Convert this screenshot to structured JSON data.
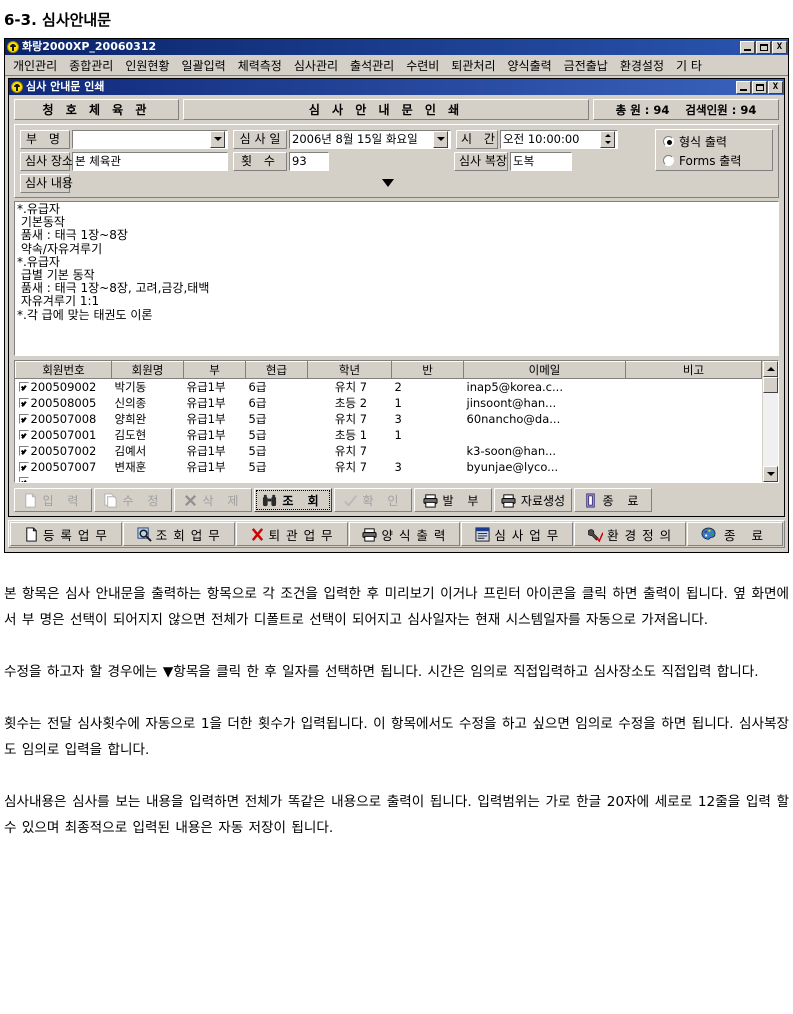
{
  "page": {
    "heading": "6-3. 심사안내문"
  },
  "app_window": {
    "title": "화랑2000XP_20060312",
    "controls": {
      "minimize": "_",
      "maximize": "□",
      "close": "X"
    },
    "menu": [
      "개인관리",
      "종합관리",
      "인원현황",
      "일괄입력",
      "체력측정",
      "심사관리",
      "출석관리",
      "수련비",
      "퇴관처리",
      "양식출력",
      "금전출납",
      "환경설정",
      "기 타"
    ]
  },
  "child_window": {
    "title": "심사 안내문 인쇄",
    "controls": {
      "minimize": "_",
      "maximize": "□",
      "close": "X"
    },
    "header": {
      "gym": "청 호 체 육 관",
      "title": "심 사 안 내 문 인 쇄",
      "total_label": "총 원 : 94",
      "searched_label": "검색인원 : 94"
    },
    "form": {
      "dept_label": "부   명",
      "dept_value": "",
      "exam_date_label": "심 사 일",
      "exam_date_value": "2006년  8월 15일 화요일",
      "time_label": "시   간",
      "time_value": "오전 10:00:00",
      "place_label": "심사 장소",
      "place_value": "본 체육관",
      "count_label": "횟   수",
      "count_value": "93",
      "uniform_label": "심사 복장",
      "uniform_value": "도복",
      "content_label": "심사 내용",
      "print_mode": {
        "option1": "형식 출력",
        "option2": "Forms 출력",
        "selected": "형식 출력"
      }
    },
    "memo": "*.유급자\n 기본동작\n 품새 : 태극 1장~8장\n 약속/자유겨루기\n*.유급자\n 급별 기본 동작\n 품새 : 태극 1장~8장, 고려,금강,태백\n 자유겨루기 1:1\n*.각 급에 맞는 태권도 이론",
    "grid": {
      "columns": [
        "회원번호",
        "회원명",
        "부",
        "현급",
        "학년",
        "반",
        "이메일",
        "비고"
      ],
      "rows": [
        {
          "checked": true,
          "no": "200509002",
          "name": "박기동",
          "dept": "유급1부",
          "grade": "6급",
          "school": "유치 7",
          "class": "2",
          "email": "inap5@korea.c...",
          "note": ""
        },
        {
          "checked": true,
          "no": "200508005",
          "name": "신의종",
          "dept": "유급1부",
          "grade": "6급",
          "school": "초등 2",
          "class": "1",
          "email": "jinsoont@han...",
          "note": ""
        },
        {
          "checked": true,
          "no": "200507008",
          "name": "양희완",
          "dept": "유급1부",
          "grade": "5급",
          "school": "유치 7",
          "class": "3",
          "email": "60nancho@da...",
          "note": ""
        },
        {
          "checked": true,
          "no": "200507001",
          "name": "김도현",
          "dept": "유급1부",
          "grade": "5급",
          "school": "초등 1",
          "class": "1",
          "email": "",
          "note": ""
        },
        {
          "checked": true,
          "no": "200507002",
          "name": "김예서",
          "dept": "유급1부",
          "grade": "5급",
          "school": "유치 7",
          "class": "",
          "email": "k3-soon@han...",
          "note": ""
        },
        {
          "checked": true,
          "no": "200507007",
          "name": "변재훈",
          "dept": "유급1부",
          "grade": "5급",
          "school": "유치 7",
          "class": "3",
          "email": "byunjae@lyco...",
          "note": ""
        }
      ]
    },
    "actions": [
      {
        "name": "input",
        "label": "입    력",
        "icon": "document-icon",
        "state": "disabled"
      },
      {
        "name": "modify",
        "label": "수    정",
        "icon": "copy-icon",
        "state": "disabled"
      },
      {
        "name": "delete",
        "label": "삭    제",
        "icon": "x-mark-icon",
        "state": "disabled"
      },
      {
        "name": "query",
        "label": "조    회",
        "icon": "binoculars-icon",
        "state": "focused"
      },
      {
        "name": "confirm",
        "label": "확    인",
        "icon": "check-icon",
        "state": "disabled"
      },
      {
        "name": "issue",
        "label": "발    부",
        "icon": "printer-icon",
        "state": "normal"
      },
      {
        "name": "generate-data",
        "label": "자료생성",
        "icon": "printer-icon",
        "state": "normal"
      },
      {
        "name": "exit",
        "label": "종    료",
        "icon": "exit-door-icon",
        "state": "normal"
      }
    ]
  },
  "module_bar": [
    {
      "name": "register",
      "label": "등 록 업 무",
      "icon": "document-icon"
    },
    {
      "name": "query",
      "label": "조 회 업 무",
      "icon": "magnifier-icon"
    },
    {
      "name": "withdraw",
      "label": "퇴 관 업 무",
      "icon": "red-x-icon"
    },
    {
      "name": "form-print",
      "label": "양 식 출 력",
      "icon": "printer-icon"
    },
    {
      "name": "exam",
      "label": "심 사 업 무",
      "icon": "window-icon"
    },
    {
      "name": "env-config",
      "label": "환 경 정 의",
      "icon": "wrench-check-icon"
    },
    {
      "name": "exit",
      "label": "종    료",
      "icon": "palette-icon"
    }
  ],
  "body_copy": {
    "paragraph1": "본 항목은 심사 안내문을 출력하는 항목으로 각 조건을 입력한 후 미리보기 이거나 프린터 아이콘을 클릭 하면 출력이 됩니다. 옆 화면에서 부 명은 선택이 되어지지 않으면 전체가 디폴트로 선택이 되어지고 심사일자는 현재 시스템일자를 자동으로 가져옵니다.",
    "paragraph2": "수정을 하고자 할 경우에는 ▼항목을 클릭 한 후 일자를 선택하면 됩니다. 시간은 임의로 직접입력하고 심사장소도 직접입력 합니다.",
    "paragraph3": "횟수는 전달 심사횟수에 자동으로 1을 더한 횟수가 입력됩니다. 이 항목에서도 수정을 하고 싶으면 임의로 수정을 하면 됩니다. 심사복장도 임의로 입력을 합니다.",
    "paragraph4": "심사내용은 심사를 보는 내용을 입력하면 전체가 똑같은 내용으로 출력이 됩니다. 입력범위는 가로 한글 20자에 세로로 12줄을 입력 할 수 있으며 최종적으로 입력된 내용은 자동 저장이 됩니다."
  }
}
